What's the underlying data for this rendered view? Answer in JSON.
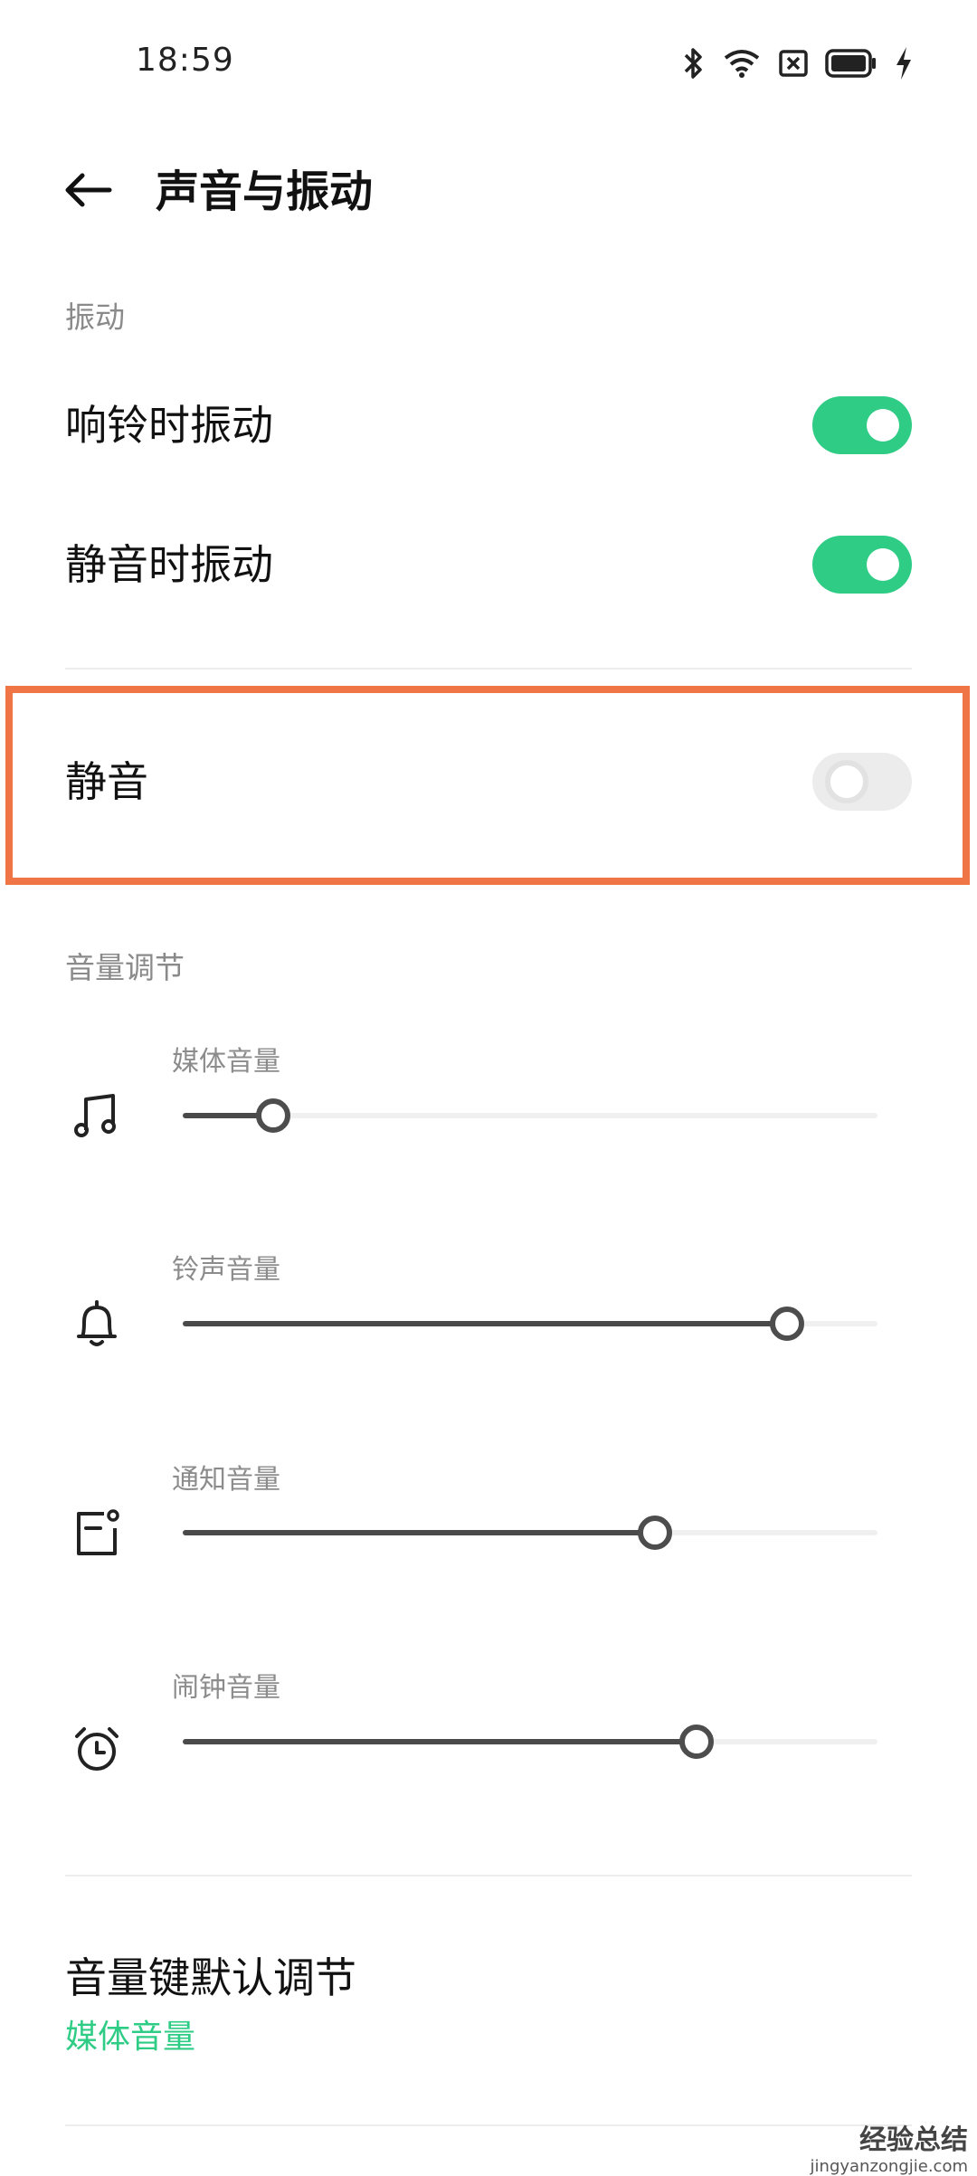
{
  "status_bar": {
    "time": "18:59",
    "icons": [
      "bluetooth-icon",
      "wifi-icon",
      "no-sim-icon",
      "battery-icon",
      "charging-icon"
    ]
  },
  "header": {
    "back_icon": "arrow-left-icon",
    "title": "声音与振动"
  },
  "vibration_section": {
    "title": "振动",
    "items": [
      {
        "label": "响铃时振动",
        "enabled": true
      },
      {
        "label": "静音时振动",
        "enabled": true
      }
    ]
  },
  "mute": {
    "label": "静音",
    "enabled": false
  },
  "volume_section": {
    "title": "音量调节",
    "sliders": [
      {
        "label": "媒体音量",
        "icon": "music-note-icon",
        "level": 0.13
      },
      {
        "label": "铃声音量",
        "icon": "bell-icon",
        "level": 0.87
      },
      {
        "label": "通知音量",
        "icon": "notification-icon",
        "level": 0.68
      },
      {
        "label": "闹钟音量",
        "icon": "alarm-clock-icon",
        "level": 0.74
      }
    ]
  },
  "volume_key_default": {
    "title": "音量键默认调节",
    "value": "媒体音量"
  },
  "watermark": {
    "main": "经验总结",
    "sub": "jingyanzongjie.com"
  },
  "colors": {
    "accent": "#2ecc85",
    "highlight_border": "#ef7446",
    "slider_active": "#4a4a4a"
  }
}
